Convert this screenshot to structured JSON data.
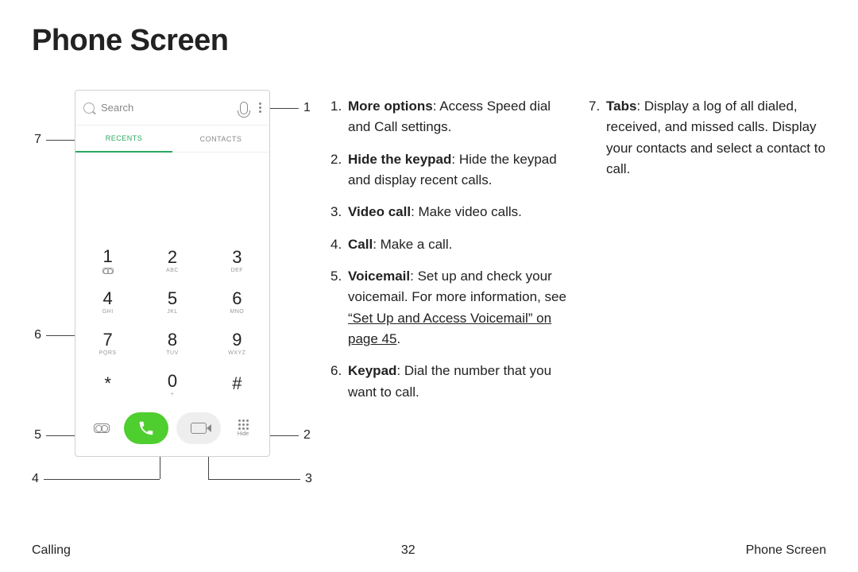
{
  "page_title": "Phone Screen",
  "phone": {
    "search_placeholder": "Search",
    "tabs": {
      "recents": "RECENTS",
      "contacts": "CONTACTS"
    },
    "keys": [
      {
        "digit": "1",
        "letters": ""
      },
      {
        "digit": "2",
        "letters": "ABC"
      },
      {
        "digit": "3",
        "letters": "DEF"
      },
      {
        "digit": "4",
        "letters": "GHI"
      },
      {
        "digit": "5",
        "letters": "JKL"
      },
      {
        "digit": "6",
        "letters": "MNO"
      },
      {
        "digit": "7",
        "letters": "PQRS"
      },
      {
        "digit": "8",
        "letters": "TUV"
      },
      {
        "digit": "9",
        "letters": "WXYZ"
      },
      {
        "digit": "*",
        "letters": ""
      },
      {
        "digit": "0",
        "letters": "+"
      },
      {
        "digit": "#",
        "letters": ""
      }
    ],
    "hide_label": "Hide"
  },
  "callouts": {
    "1": {
      "bold": "More options",
      "text": ": Access Speed dial and Call settings."
    },
    "2": {
      "bold": "Hide the keypad",
      "text": ": Hide the keypad and display recent calls."
    },
    "3": {
      "bold": "Video call",
      "text": ": Make video calls."
    },
    "4": {
      "bold": "Call",
      "text": ": Make a call."
    },
    "5": {
      "bold": "Voicemail",
      "text": ": Set up and check your voicemail. For more information, see ",
      "link": "“Set Up and Access Voicemail” on page 45",
      "after": "."
    },
    "6": {
      "bold": "Keypad",
      "text": ": Dial the number that you want to call."
    },
    "7": {
      "bold": "Tabs",
      "text": ": Display a log of all dialed, received, and missed calls. Display your contacts and select a contact to call."
    }
  },
  "nums": {
    "n1": "1",
    "n2": "2",
    "n3": "3",
    "n4": "4",
    "n5": "5",
    "n6": "6",
    "n7": "7"
  },
  "footer": {
    "left": "Calling",
    "center": "32",
    "right": "Phone Screen"
  }
}
